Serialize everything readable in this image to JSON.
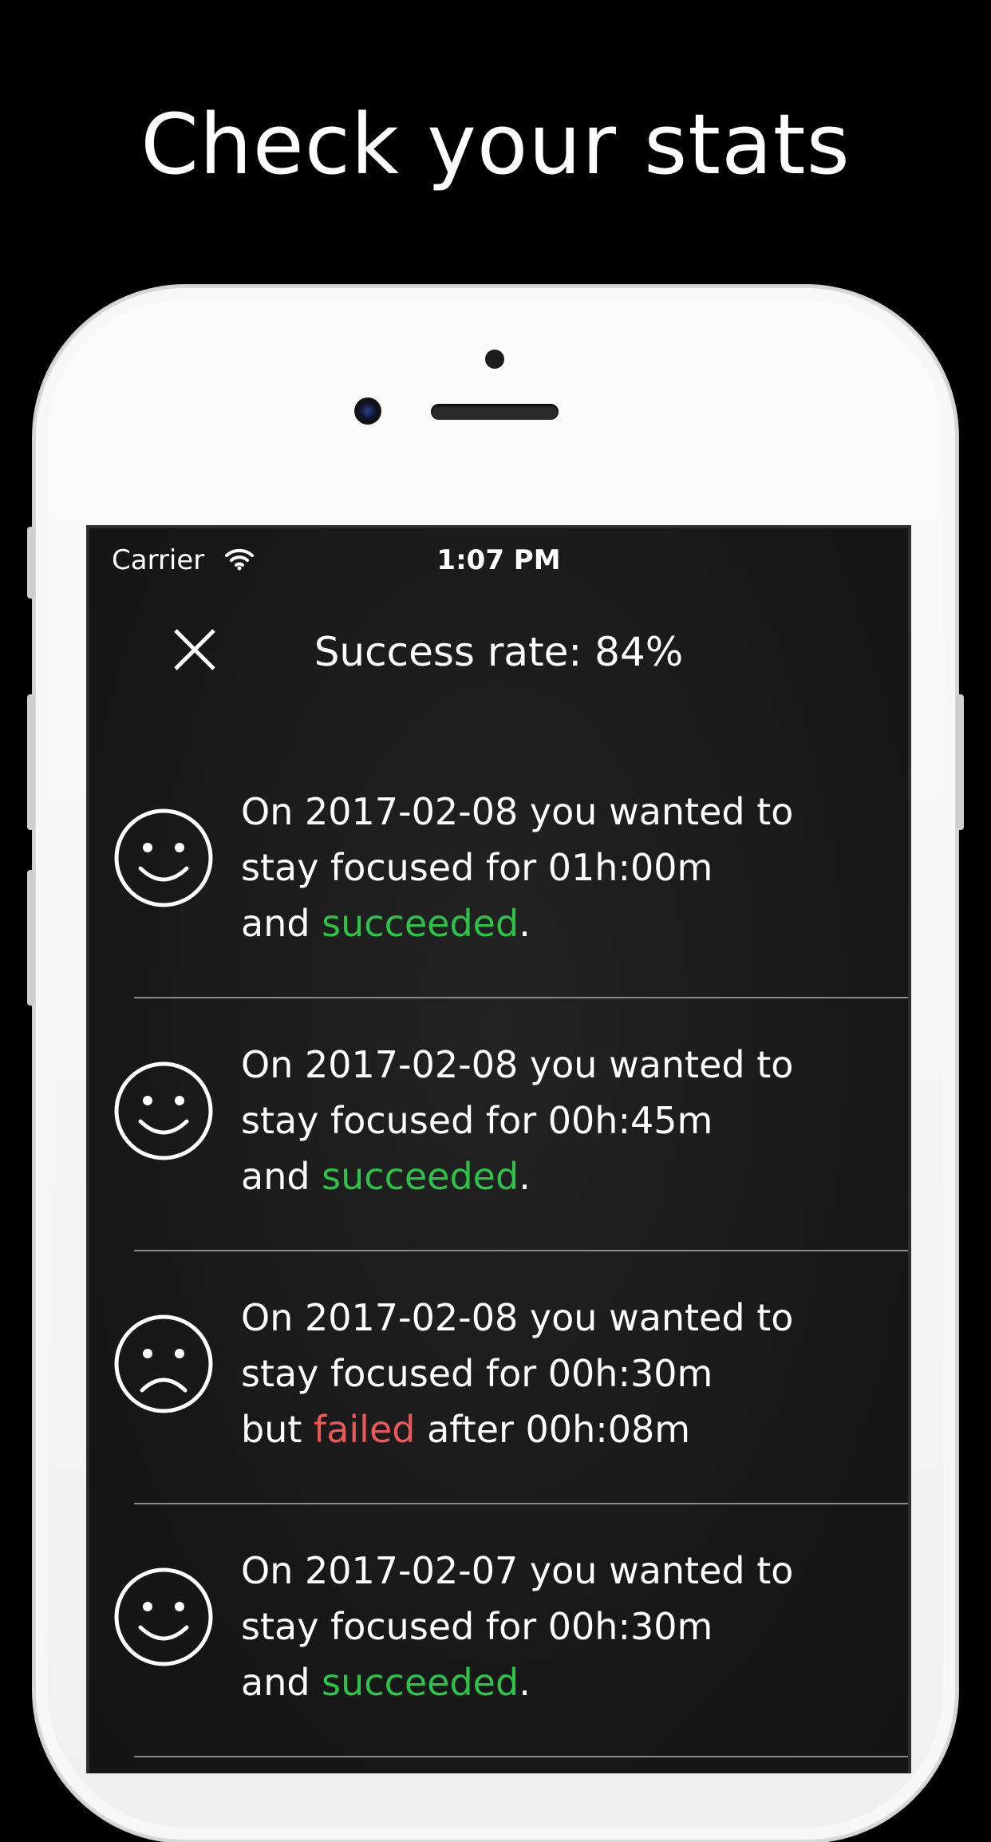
{
  "headline": "Check your stats",
  "statusbar": {
    "carrier": "Carrier",
    "time": "1:07 PM"
  },
  "header": {
    "title": "Success rate: 84%"
  },
  "colors": {
    "success": "#2ec24a",
    "failure": "#e85a5a",
    "background": "#000000"
  },
  "sessions": [
    {
      "icon": "happy-face-icon",
      "line1": "On 2017-02-08 you wanted to",
      "line2": "stay focused for 01h:00m",
      "prefix": "and ",
      "result": "succeeded",
      "suffix": "."
    },
    {
      "icon": "happy-face-icon",
      "line1": "On 2017-02-08 you wanted to",
      "line2": "stay focused for 00h:45m",
      "prefix": "and ",
      "result": "succeeded",
      "suffix": "."
    },
    {
      "icon": "sad-face-icon",
      "line1": "On 2017-02-08 you wanted to",
      "line2": "stay focused for 00h:30m",
      "prefix": "but ",
      "result": "failed",
      "suffix": " after 00h:08m"
    },
    {
      "icon": "happy-face-icon",
      "line1": "On 2017-02-07 you wanted to",
      "line2": "stay focused for 00h:30m",
      "prefix": "and ",
      "result": "succeeded",
      "suffix": "."
    }
  ]
}
